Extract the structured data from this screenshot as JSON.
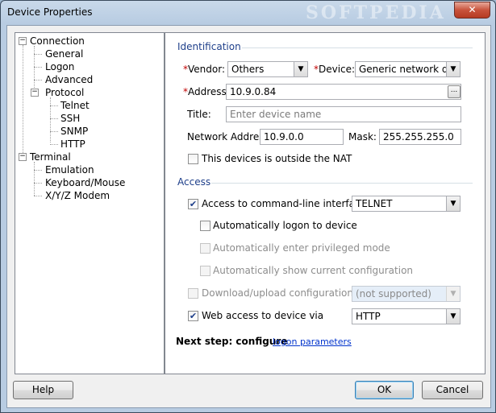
{
  "window": {
    "title": "Device Properties",
    "watermark": "SOFTPEDIA",
    "close_symbol": "✕"
  },
  "tree": {
    "connection": "Connection",
    "general": "General",
    "logon": "Logon",
    "advanced": "Advanced",
    "protocol": "Protocol",
    "telnet": "Telnet",
    "ssh": "SSH",
    "snmp": "SNMP",
    "http": "HTTP",
    "terminal": "Terminal",
    "emulation": "Emulation",
    "keyboard_mouse": "Keyboard/Mouse",
    "xyz_modem": "X/Y/Z Modem",
    "expand_symbol": "−"
  },
  "identification": {
    "section": "Identification",
    "vendor_label": "Vendor:",
    "vendor_value": "Others",
    "device_label": "Device:",
    "device_value": "Generic network devic",
    "address_label": "Address:",
    "address_value": "10.9.0.84",
    "browse_label": "...",
    "title_label": "Title:",
    "title_placeholder": "Enter device name",
    "network_label": "Network Address:",
    "network_value": "10.9.0.0",
    "mask_label": "Mask:",
    "mask_value": "255.255.255.0",
    "nat_label": "This devices is outside the NAT",
    "required_mark": "*"
  },
  "access": {
    "section": "Access",
    "cli_label": "Access to command-line interface via",
    "cli_value": "TELNET",
    "auto_logon_label": "Automatically logon to device",
    "privileged_label": "Automatically enter privileged mode",
    "show_config_label": "Automatically show current configuration",
    "download_label": "Download/upload configuration via",
    "download_value": "(not supported)",
    "web_label": "Web access to device via",
    "web_value": "HTTP"
  },
  "next_step": {
    "prefix": "Next step: configure",
    "link": "logon parameters"
  },
  "buttons": {
    "help": "Help",
    "ok": "OK",
    "cancel": "Cancel"
  },
  "symbols": {
    "dropdown": "▼",
    "check": "✔"
  }
}
